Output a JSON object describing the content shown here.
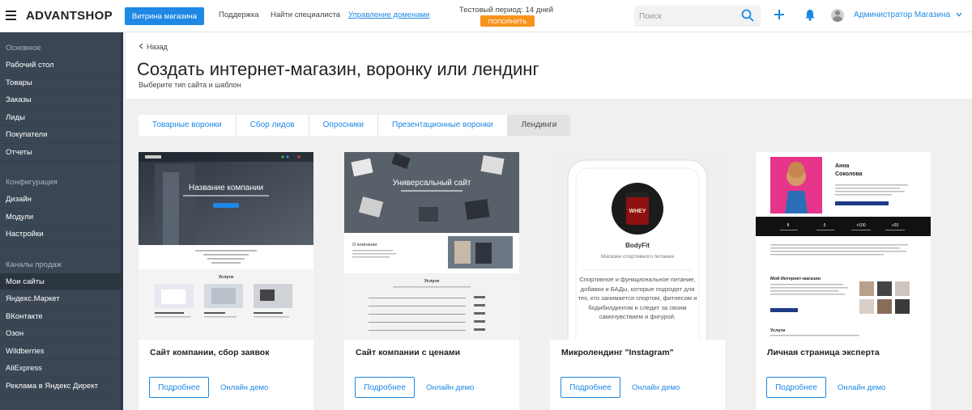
{
  "header": {
    "logo": "ADVANTSHOP",
    "storefront_button": "Витрина магазина",
    "links": [
      "Поддержка",
      "Найти специалиста",
      "Управление доменами"
    ],
    "trial_text": "Тестовый период: 14 дней",
    "topup_button": "ПОПОЛНИТЬ",
    "search_placeholder": "Поиск",
    "user_name": "Администратор Магазина",
    "accent_color": "#1e88e5",
    "topup_color": "#f7941d"
  },
  "sidebar": {
    "sections": [
      {
        "title": "Основное",
        "items": [
          "Рабочий стол",
          "Товары",
          "Заказы",
          "Лиды",
          "Покупатели",
          "Отчеты"
        ]
      },
      {
        "title": "Конфигурация",
        "items": [
          "Дизайн",
          "Модули",
          "Настройки"
        ]
      },
      {
        "title": "Каналы продаж",
        "items": [
          "Мои сайты",
          "Яндекс.Маркет",
          "ВКонтакте",
          "Озон",
          "Wildberries",
          "AliExpress",
          "Реклама в Яндекс Директ"
        ]
      }
    ],
    "active_item": "Мои сайты",
    "background": "#3a4654"
  },
  "page": {
    "back": "Назад",
    "title": "Создать интернет-магазин, воронку или лендинг",
    "subtitle": "Выберите тип сайта и шаблон"
  },
  "tabs": [
    {
      "label": "Товарные воронки",
      "active": false
    },
    {
      "label": "Сбор лидов",
      "active": false
    },
    {
      "label": "Опросники",
      "active": false
    },
    {
      "label": "Презентационные воронки",
      "active": false
    },
    {
      "label": "Лендинги",
      "active": true
    }
  ],
  "cards": [
    {
      "title": "Сайт компании, сбор заявок",
      "more": "Подробнее",
      "demo": "Онлайн демо",
      "preview": {
        "hero": "Название компании",
        "section": "Услуги"
      }
    },
    {
      "title": "Сайт компании с ценами",
      "more": "Подробнее",
      "demo": "Онлайн демо",
      "preview": {
        "hero": "Универсальный сайт",
        "about": "О компании",
        "section": "Услуги"
      }
    },
    {
      "title": "Микролендинг \"Instagram\"",
      "more": "Подробнее",
      "demo": "Онлайн демо",
      "preview": {
        "brand": "BodyFit",
        "tagline": "Магазин спортивного питания",
        "product": "WHEY",
        "text": "Спортивное и функциональное питание, добавки и БАДы, которые подходят для тех, кто занимается спортом, фитнесом и бодибилдингом и следит за своим самочувствием и фигурой."
      }
    },
    {
      "title": "Личная страница эксперта",
      "more": "Подробнее",
      "demo": "Онлайн демо",
      "preview": {
        "name": "Анна Соколова",
        "stats": [
          "8",
          "5",
          ">100",
          ">20"
        ],
        "section_title": "Мой Интернет-магазин",
        "section": "Услуги"
      }
    }
  ]
}
